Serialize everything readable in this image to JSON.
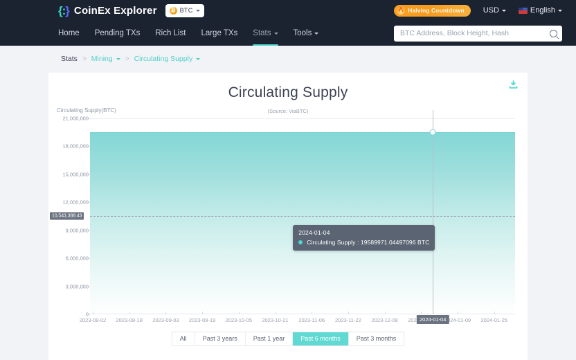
{
  "header": {
    "logo_mark_left": "{:",
    "logo_mark_right": "}",
    "logo_text": "CoinEx Explorer",
    "coin_symbol": "₿",
    "coin_label": "BTC",
    "halving_badge": "Halving Countdown",
    "flame_icon": "🔥",
    "currency": "USD",
    "language": "English",
    "nav": [
      {
        "label": "Home",
        "active": false,
        "has_caret": false
      },
      {
        "label": "Pending TXs",
        "active": false,
        "has_caret": false
      },
      {
        "label": "Rich List",
        "active": false,
        "has_caret": false
      },
      {
        "label": "Large TXs",
        "active": false,
        "has_caret": false
      },
      {
        "label": "Stats",
        "active": true,
        "has_caret": true
      },
      {
        "label": "Tools",
        "active": false,
        "has_caret": true
      }
    ],
    "search_placeholder": "BTC Address, Block Height, Hash",
    "search_value": ""
  },
  "breadcrumb": {
    "root": "Stats",
    "sep": ">",
    "level1": "Mining",
    "level2": "Circulating Supply"
  },
  "card": {
    "download_icon": "download-icon"
  },
  "colors": {
    "accent": "#4fd6cc",
    "area_top": "#83d7d6",
    "line": "#6fcfcd",
    "tooltip_bg": "#5a6472",
    "header_bg": "#1b2230",
    "badge_orange": "#f59b1f"
  },
  "tooltip": {
    "date": "2024-01-04",
    "series_label": "Circulating Supply",
    "separator": ":",
    "value": "19589971.04497096",
    "unit": "BTC",
    "full_line": "Circulating Supply : 19589971.04497096 BTC"
  },
  "axis_marker": {
    "y_value_label": "10,543,388.43",
    "x_value_label": "2024-01-04"
  },
  "ranges": {
    "options": [
      "All",
      "Past 3 years",
      "Past 1 year",
      "Past 6 months",
      "Past 3 months"
    ],
    "selected": "Past 6 months"
  },
  "chart_data": {
    "type": "area",
    "title": "Circulating Supply",
    "ylabel": "Circulating Supply(BTC)",
    "xlabel": "",
    "source": "(Source: ViaBTC)",
    "ylim": [
      0,
      21000000
    ],
    "yticks": [
      0,
      3000000,
      6000000,
      9000000,
      12000000,
      15000000,
      18000000,
      21000000
    ],
    "ytick_labels": [
      "0",
      "3,000,000",
      "6,000,000",
      "9,000,000",
      "12,000,000",
      "15,000,000",
      "18,000,000",
      "21,000,000"
    ],
    "grid": true,
    "legend": false,
    "xticks": [
      "2023-08-02",
      "2023-08-18",
      "2023-09-03",
      "2023-09-19",
      "2023-10-05",
      "2023-10-21",
      "2023-11-06",
      "2023-11-22",
      "2023-12-08",
      "2023-12-24",
      "2024-01-09",
      "2024-01-25"
    ],
    "highlighted_xtick": "2024-01-04",
    "hover_marker_y_label": "10,543,388.43",
    "series": [
      {
        "name": "Circulating Supply",
        "unit": "BTC",
        "color": "#6fcfcd",
        "x": [
          "2023-08-02",
          "2023-08-18",
          "2023-09-03",
          "2023-09-19",
          "2023-10-05",
          "2023-10-21",
          "2023-11-06",
          "2023-11-22",
          "2023-12-08",
          "2023-12-24",
          "2024-01-04",
          "2024-01-09",
          "2024-01-25"
        ],
        "values": [
          19446000,
          19465000,
          19484000,
          19503000,
          19522000,
          19540000,
          19558000,
          19566000,
          19578000,
          19584000,
          19589971.04497096,
          19592000,
          19610000
        ],
        "hover_point": {
          "x": "2024-01-04",
          "y": 19589971.04497096
        }
      }
    ],
    "annotations": [
      {
        "type": "crosshair",
        "x": "2024-01-04"
      },
      {
        "type": "y-axis-tag",
        "label": "10,543,388.43"
      }
    ]
  }
}
